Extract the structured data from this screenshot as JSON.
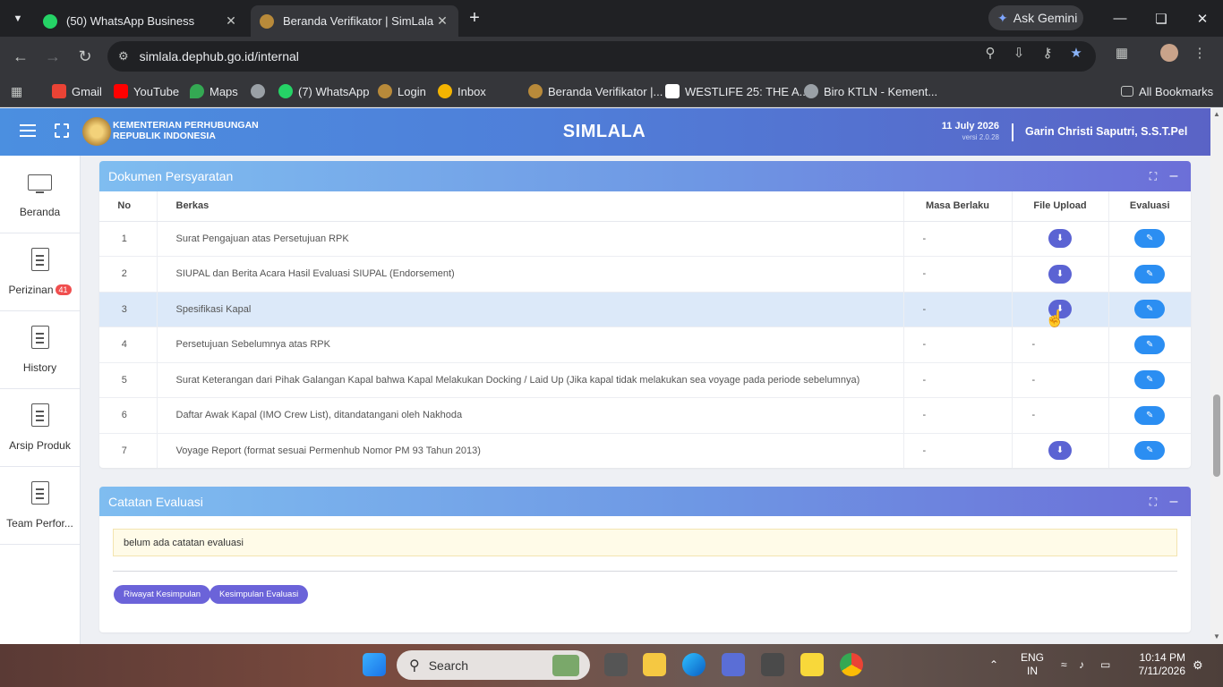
{
  "browser": {
    "tabs": [
      {
        "title": "(50) WhatsApp Business",
        "active": false
      },
      {
        "title": "Beranda Verifikator | SimLala",
        "active": true
      }
    ],
    "address": "simlala.dephub.go.id/internal",
    "gemini_label": "Ask Gemini",
    "bookmarks": [
      "Gmail",
      "YouTube",
      "Maps",
      "(7) WhatsApp",
      "Login",
      "Inbox",
      "Beranda Verifikator |...",
      "WESTLIFE 25: THE A...",
      "Biro KTLN - Kement..."
    ],
    "all_bookmarks": "All Bookmarks"
  },
  "header": {
    "org_line1": "KEMENTERIAN PERHUBUNGAN",
    "org_line2": "REPUBLIK INDONESIA",
    "app_title": "SIMLALA",
    "date": "11 July 2026",
    "version": "versi 2.0.28",
    "user": "Garin Christi Saputri, S.S.T.Pel"
  },
  "sidebar": {
    "items": [
      {
        "label": "Beranda",
        "icon": "monitor-icon"
      },
      {
        "label": "Perizinan",
        "icon": "document-icon",
        "badge": "41"
      },
      {
        "label": "History",
        "icon": "document-icon"
      },
      {
        "label": "Arsip Produk",
        "icon": "document-icon"
      },
      {
        "label": "Team Perfor...",
        "icon": "document-icon"
      }
    ]
  },
  "documents": {
    "title": "Dokumen Persyaratan",
    "columns": [
      "No",
      "Berkas",
      "Masa Berlaku",
      "File Upload",
      "Evaluasi"
    ],
    "rows": [
      {
        "no": "1",
        "berkas": "Surat Pengajuan atas Persetujuan RPK",
        "masa": "-",
        "upload": true
      },
      {
        "no": "2",
        "berkas": "SIUPAL dan Berita Acara Hasil Evaluasi SIUPAL (Endorsement)",
        "masa": "-",
        "upload": true
      },
      {
        "no": "3",
        "berkas": "Spesifikasi Kapal",
        "masa": "-",
        "upload": true
      },
      {
        "no": "4",
        "berkas": "Persetujuan Sebelumnya atas RPK",
        "masa": "-",
        "upload": false
      },
      {
        "no": "5",
        "berkas": "Surat Keterangan dari Pihak Galangan Kapal bahwa Kapal Melakukan Docking / Laid Up (Jika kapal tidak melakukan sea voyage pada periode sebelumnya)",
        "masa": "-",
        "upload": false
      },
      {
        "no": "6",
        "berkas": "Daftar Awak Kapal (IMO Crew List), ditandatangani oleh Nakhoda",
        "masa": "-",
        "upload": false
      },
      {
        "no": "7",
        "berkas": "Voyage Report (format sesuai Permenhub Nomor PM 93 Tahun 2013)",
        "masa": "-",
        "upload": true
      }
    ],
    "no_upload_text": "-"
  },
  "evaluation": {
    "title": "Catatan Evaluasi",
    "note": "belum ada catatan evaluasi",
    "btn_history": "Riwayat Kesimpulan",
    "btn_conclusion": "Kesimpulan Evaluasi"
  },
  "taskbar": {
    "search_placeholder": "Search",
    "lang_line1": "ENG",
    "lang_line2": "IN",
    "time": "10:14 PM",
    "date": "7/11/2026"
  },
  "colors": {
    "primary": "#5b63d3",
    "evaluate": "#2b8ef2",
    "header_start": "#4b8fe0",
    "header_end": "#5a63c6"
  }
}
